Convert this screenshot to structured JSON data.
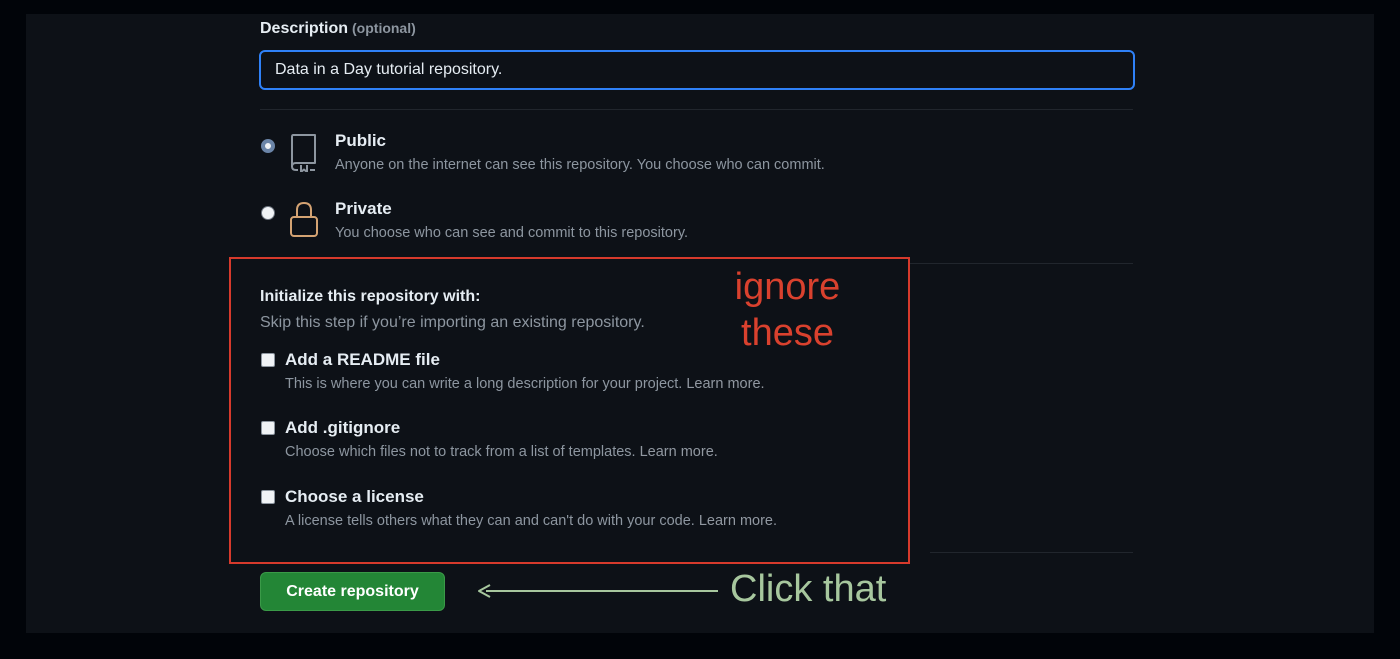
{
  "description": {
    "label": "Description",
    "optional": "(optional)",
    "value": "Data in a Day tutorial repository."
  },
  "visibility": {
    "public": {
      "title": "Public",
      "desc": "Anyone on the internet can see this repository. You choose who can commit.",
      "selected": true,
      "icon": "repo-icon"
    },
    "private": {
      "title": "Private",
      "desc": "You choose who can see and commit to this repository.",
      "selected": false,
      "icon": "lock-icon"
    }
  },
  "initialize": {
    "title": "Initialize this repository with:",
    "subtitle": "Skip this step if you’re importing an existing repository.",
    "options": [
      {
        "title": "Add a README file",
        "desc": "This is where you can write a long description for your project.",
        "link": "Learn more."
      },
      {
        "title": "Add .gitignore",
        "desc": "Choose which files not to track from a list of templates.",
        "link": "Learn more."
      },
      {
        "title": "Choose a license",
        "desc": "A license tells others what they can and can't do with your code.",
        "link": "Learn more."
      }
    ]
  },
  "create_button": "Create repository",
  "annotations": {
    "ignore_line1": "ignore",
    "ignore_line2": "these",
    "click": "Click that"
  },
  "colors": {
    "background": "#0d1117",
    "primary_button": "#238636",
    "focus_border": "#2f81f7",
    "annotation_red": "#d63a2c",
    "annotation_green": "#a7c79e"
  }
}
